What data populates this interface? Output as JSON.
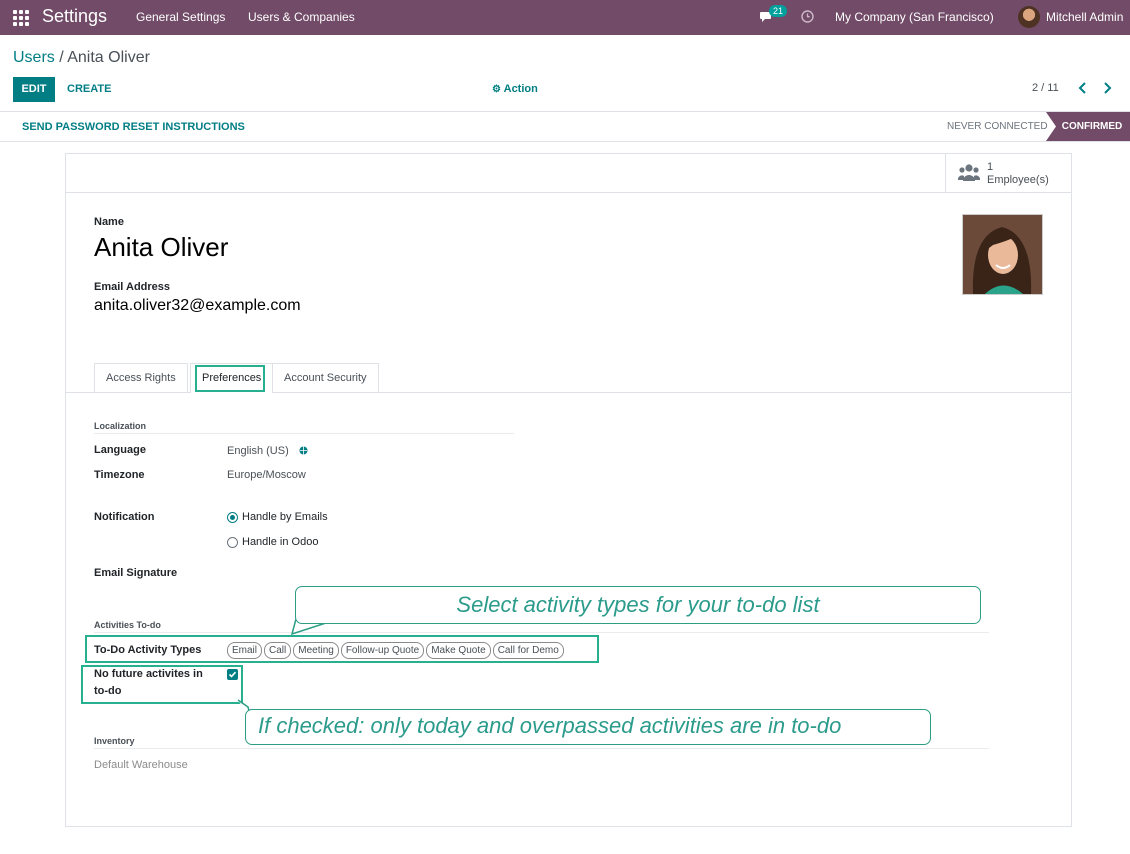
{
  "navbar": {
    "app_title": "Settings",
    "menu": [
      "General Settings",
      "Users & Companies"
    ],
    "chat_badge": "21",
    "company": "My Company (San Francisco)",
    "user": "Mitchell Admin"
  },
  "control_panel": {
    "breadcrumb_parent": "Users",
    "breadcrumb_sep": " / ",
    "breadcrumb_current": "Anita Oliver",
    "edit_label": "EDIT",
    "create_label": "CREATE",
    "action_label": "Action",
    "pager": "2 / 11"
  },
  "statusbar": {
    "reset_label": "SEND PASSWORD RESET INSTRUCTIONS",
    "stage_never": "NEVER CONNECTED",
    "stage_confirmed": "CONFIRMED"
  },
  "buttonbox": {
    "employee_count": "1",
    "employee_label": "Employee(s)"
  },
  "form": {
    "name_label": "Name",
    "name_value": "Anita Oliver",
    "email_label": "Email Address",
    "email_value": "anita.oliver32@example.com"
  },
  "tabs": [
    "Access Rights",
    "Preferences",
    "Account Security"
  ],
  "preferences": {
    "localization_title": "Localization",
    "language_label": "Language",
    "language_value": "English (US)",
    "timezone_label": "Timezone",
    "timezone_value": "Europe/Moscow",
    "notification_label": "Notification",
    "notification_options": [
      "Handle by Emails",
      "Handle in Odoo"
    ],
    "signature_label": "Email Signature",
    "activities_title": "Activities To-do",
    "activity_types_label": "To-Do Activity Types",
    "activity_types": [
      "Email",
      "Call",
      "Meeting",
      "Follow-up Quote",
      "Make Quote",
      "Call for Demo"
    ],
    "no_future_label_1": "No future activites in",
    "no_future_label_2": "to-do",
    "no_future_checked": true,
    "inventory_title": "Inventory",
    "warehouse_label": "Default Warehouse"
  },
  "callouts": {
    "activity_types": "Select activity types for your to-do list",
    "no_future": "If checked: only today and overpassed activities are in to-do"
  },
  "colors": {
    "brand": "#714b67",
    "accent": "#017e84",
    "highlight": "#26b08f"
  }
}
